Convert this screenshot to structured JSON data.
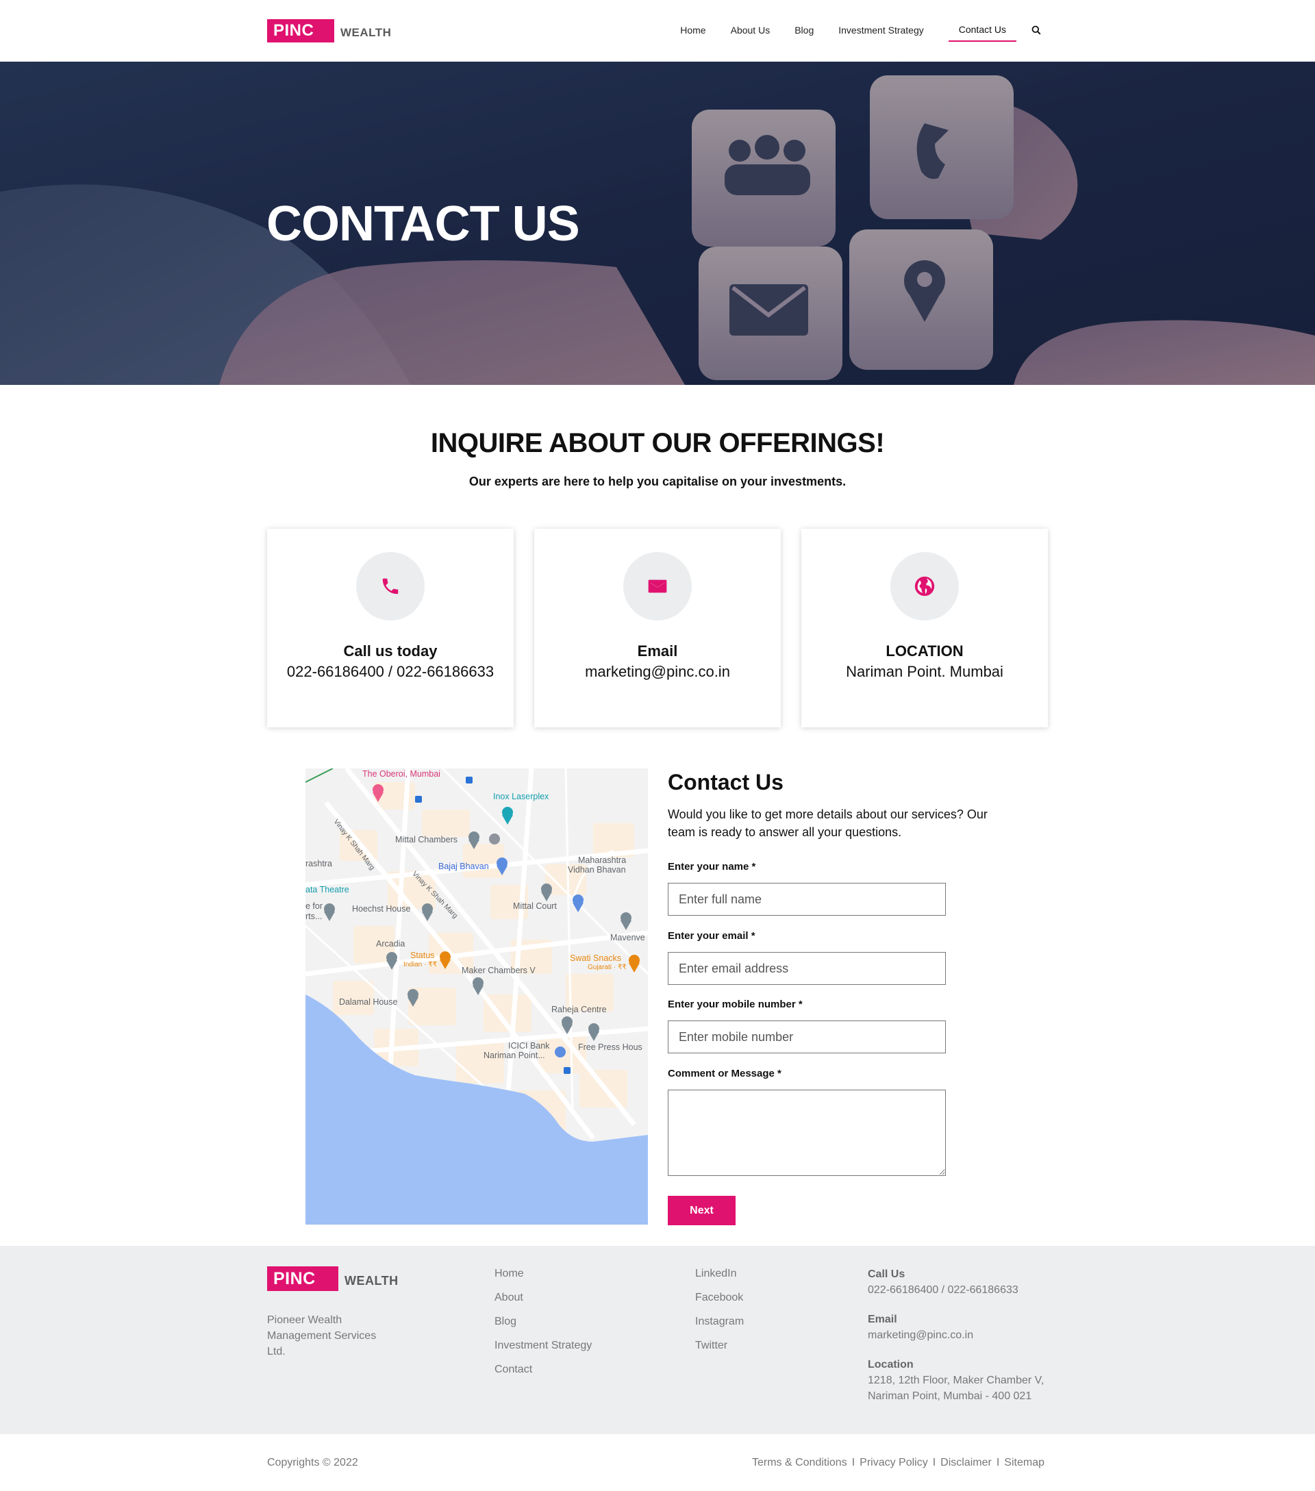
{
  "brand": {
    "logo_text": "PINC",
    "logo_sub": "WEALTH",
    "accent": "#e0126f"
  },
  "nav": {
    "items": [
      {
        "label": "Home"
      },
      {
        "label": "About Us"
      },
      {
        "label": "Blog"
      },
      {
        "label": "Investment Strategy"
      },
      {
        "label": "Contact Us"
      }
    ],
    "active": "Contact Us",
    "search_icon": "search-icon"
  },
  "hero": {
    "title": "CONTACT US"
  },
  "inquire": {
    "title": "INQUIRE ABOUT OUR OFFERINGS!",
    "subtitle": "Our experts are here to help you capitalise on your investments."
  },
  "cards": [
    {
      "icon": "phone-icon",
      "title": "Call us today",
      "value": "022-66186400 / 022-66186633"
    },
    {
      "icon": "mail-icon",
      "title": "Email",
      "value": "marketing@pinc.co.in"
    },
    {
      "icon": "globe-icon",
      "title": "LOCATION",
      "value": "Nariman Point. Mumbai"
    }
  ],
  "map": {
    "labels": [
      "The Oberoi, Mumbai",
      "Inox Laserplex",
      "Mittal Chambers",
      "Maharashtra",
      "Vidhan Bhavan",
      "Bajaj Bhavan",
      "rashtra",
      "ata Theatre",
      "e for",
      "rts...",
      "Hoechst House",
      "Mittal Court",
      "Mavenve",
      "Arcadia",
      "Status",
      "Indian · ₹₹",
      "Swati Snacks",
      "Gujarati · ₹₹",
      "Maker Chambers V",
      "Dalamal House",
      "Raheja Centre",
      "ICICI Bank",
      "Nariman Point...",
      "Free Press Hous",
      "Vinay K Shah Marg",
      "Vinay K Shah Marg"
    ]
  },
  "form": {
    "title": "Contact Us",
    "description": "Would you like to get more details about our services? Our team is ready to answer all your questions.",
    "name_label": "Enter your name *",
    "name_placeholder": "Enter full name",
    "email_label": "Enter your email *",
    "email_placeholder": "Enter email address",
    "mobile_label": "Enter your mobile number *",
    "mobile_placeholder": "Enter mobile number",
    "message_label": "Comment or Message *",
    "submit_label": "Next"
  },
  "footer": {
    "company": "Pioneer Wealth Management Services Ltd.",
    "links": [
      {
        "label": "Home"
      },
      {
        "label": "About"
      },
      {
        "label": "Blog"
      },
      {
        "label": "Investment Strategy"
      },
      {
        "label": "Contact"
      }
    ],
    "social": [
      {
        "label": "LinkedIn"
      },
      {
        "label": "Facebook"
      },
      {
        "label": "Instagram"
      },
      {
        "label": "Twitter"
      }
    ],
    "call_head": "Call Us",
    "call_val": "022-66186400 / 022-66186633",
    "email_head": "Email",
    "email_val": "marketing@pinc.co.in",
    "location_head": "Location",
    "location_line1": "1218, 12th Floor, Maker Chamber V,",
    "location_line2": "Nariman Point, Mumbai - 400 021"
  },
  "bottom": {
    "copyright": "Copyrights © 2022",
    "legal": [
      {
        "label": "Terms & Conditions"
      },
      {
        "label": "Privacy Policy"
      },
      {
        "label": "Disclaimer"
      },
      {
        "label": "Sitemap"
      }
    ],
    "separator": "I"
  }
}
